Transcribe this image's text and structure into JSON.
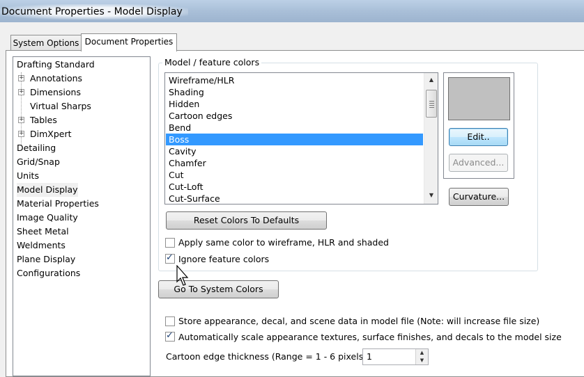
{
  "window": {
    "title": "Document Properties - Model Display"
  },
  "tabs": [
    {
      "label": "System Options"
    },
    {
      "label": "Document Properties"
    }
  ],
  "tree": {
    "items": [
      {
        "label": "Drafting Standard"
      },
      {
        "label": "Annotations"
      },
      {
        "label": "Dimensions"
      },
      {
        "label": "Virtual Sharps"
      },
      {
        "label": "Tables"
      },
      {
        "label": "DimXpert"
      },
      {
        "label": "Detailing"
      },
      {
        "label": "Grid/Snap"
      },
      {
        "label": "Units"
      },
      {
        "label": "Model Display"
      },
      {
        "label": "Material Properties"
      },
      {
        "label": "Image Quality"
      },
      {
        "label": "Sheet Metal"
      },
      {
        "label": "Weldments"
      },
      {
        "label": "Plane Display"
      },
      {
        "label": "Configurations"
      }
    ],
    "selected": "Model Display"
  },
  "model_colors": {
    "group_label": "Model / feature colors",
    "items": [
      {
        "label": "Wireframe/HLR"
      },
      {
        "label": "Shading"
      },
      {
        "label": "Hidden"
      },
      {
        "label": "Cartoon edges"
      },
      {
        "label": "Bend"
      },
      {
        "label": "Boss"
      },
      {
        "label": "Cavity"
      },
      {
        "label": "Chamfer"
      },
      {
        "label": "Cut"
      },
      {
        "label": "Cut-Loft"
      },
      {
        "label": "Cut-Surface"
      }
    ],
    "selected": "Boss",
    "swatch_color": "#c0c0c0",
    "edit_label": "Edit..",
    "advanced_label": "Advanced...",
    "curvature_label": "Curvature...",
    "reset_label": "Reset Colors To Defaults",
    "apply_same_label": "Apply same color to wireframe, HLR and shaded",
    "apply_same_checked": false,
    "ignore_feature_label": "Ignore feature colors",
    "ignore_feature_checked": true
  },
  "system_colors_label": "Go To System Colors",
  "store_label": "Store appearance, decal, and scene data in model file (Note: will increase file size)",
  "store_checked": false,
  "autoscale_label": "Automatically scale appearance textures, surface finishes, and decals to the model size",
  "autoscale_checked": true,
  "cartoon_label": "Cartoon edge thickness (Range = 1 - 6 pixels):",
  "cartoon_value": "1",
  "colors": {
    "selection": "#3399ff",
    "titlebar": "#a9bfd8"
  }
}
